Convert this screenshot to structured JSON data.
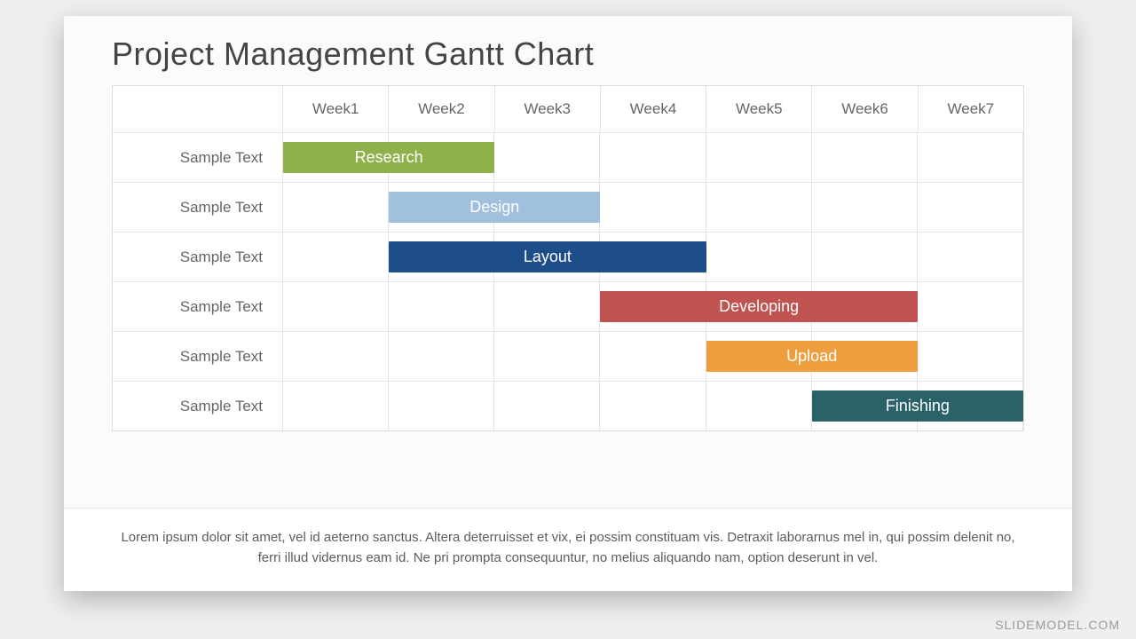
{
  "title": "Project Management Gantt Chart",
  "weeks": [
    "Week1",
    "Week2",
    "Week3",
    "Week4",
    "Week5",
    "Week6",
    "Week7"
  ],
  "rows": [
    {
      "label": "Sample Text",
      "bar": {
        "name": "Research",
        "start": 0,
        "span": 2,
        "color": "#8fb14a"
      }
    },
    {
      "label": "Sample Text",
      "bar": {
        "name": "Design",
        "start": 1,
        "span": 2,
        "color": "#a0c0dd"
      }
    },
    {
      "label": "Sample Text",
      "bar": {
        "name": "Layout",
        "start": 1,
        "span": 3,
        "color": "#1d4e89"
      }
    },
    {
      "label": "Sample Text",
      "bar": {
        "name": "Developing",
        "start": 3,
        "span": 3,
        "color": "#c0524f"
      }
    },
    {
      "label": "Sample Text",
      "bar": {
        "name": "Upload",
        "start": 4,
        "span": 2,
        "color": "#ef9e3f"
      }
    },
    {
      "label": "Sample Text",
      "bar": {
        "name": "Finishing",
        "start": 5,
        "span": 2,
        "color": "#2b6169"
      }
    }
  ],
  "footer": "Lorem ipsum dolor sit amet, vel id aeterno sanctus. Altera deterruisset et vix, ei possim constituam vis. Detraxit laborarnus mel in, qui possim delenit no, ferri illud vidernus eam id. Ne pri prompta consequuntur, no melius aliquando nam, option deserunt in vel.",
  "watermark": "SLIDEMODEL.COM",
  "chart_data": {
    "type": "bar",
    "orientation": "horizontal-gantt",
    "title": "Project Management Gantt Chart",
    "x_categories": [
      "Week1",
      "Week2",
      "Week3",
      "Week4",
      "Week5",
      "Week6",
      "Week7"
    ],
    "series": [
      {
        "name": "Research",
        "row": "Sample Text",
        "start_week": 1,
        "end_week": 2,
        "color": "#8fb14a"
      },
      {
        "name": "Design",
        "row": "Sample Text",
        "start_week": 2,
        "end_week": 3,
        "color": "#a0c0dd"
      },
      {
        "name": "Layout",
        "row": "Sample Text",
        "start_week": 2,
        "end_week": 4,
        "color": "#1d4e89"
      },
      {
        "name": "Developing",
        "row": "Sample Text",
        "start_week": 4,
        "end_week": 6,
        "color": "#c0524f"
      },
      {
        "name": "Upload",
        "row": "Sample Text",
        "start_week": 5,
        "end_week": 6,
        "color": "#ef9e3f"
      },
      {
        "name": "Finishing",
        "row": "Sample Text",
        "start_week": 6,
        "end_week": 7,
        "color": "#2b6169"
      }
    ],
    "xlabel": "",
    "ylabel": "",
    "xlim": [
      1,
      7
    ]
  }
}
